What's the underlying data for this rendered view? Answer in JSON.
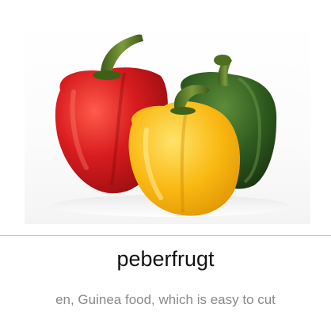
{
  "card": {
    "image": {
      "subject": "bell-peppers",
      "colors": {
        "red": "#c8161a",
        "yellow": "#f7b90f",
        "green": "#2f5a1f",
        "stem": "#4f6f25"
      }
    },
    "word": "peberfrugt",
    "definition": "en, Guinea food, which is easy to cut",
    "text_colors": {
      "word": "#111111",
      "definition": "#8a8a8a",
      "divider": "#c7c7c7"
    }
  }
}
